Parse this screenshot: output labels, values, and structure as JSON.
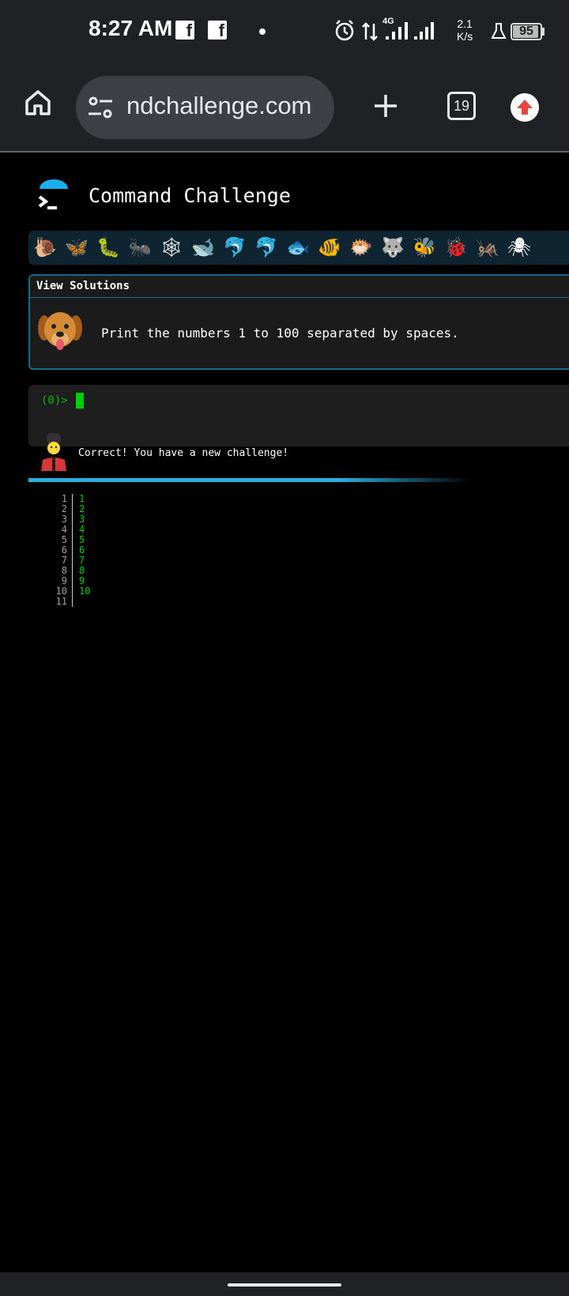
{
  "status_bar": {
    "time": "8:27 AM",
    "network_type": "4G",
    "speed_value": "2.1",
    "speed_unit": "K/s",
    "battery_level": "95",
    "icons": [
      "facebook-icon",
      "facebook-icon",
      "dot-icon",
      "alarm-icon",
      "data-arrows-icon",
      "signal-icon",
      "signal-icon",
      "flask-icon",
      "battery-icon"
    ]
  },
  "browser": {
    "url": "ndchallenge.com",
    "tab_count": "19",
    "icons": [
      "home-icon",
      "tune-icon",
      "plus-icon",
      "tabs-icon",
      "update-icon"
    ]
  },
  "site": {
    "title": "Command Challenge",
    "view_solutions": "View Solutions",
    "challenge_text": "Print the numbers 1 to 100 separated by spaces.",
    "prompt": "(0)>",
    "feedback": "Correct! You have a new challenge!",
    "progress_fraction": 0.7,
    "badges": [
      "🐌",
      "🦋",
      "🐛",
      "🐜",
      "🕸",
      "🐋",
      "🐬",
      "🐬",
      "🐟",
      "🐠",
      "🐡",
      "🐺",
      "🐝",
      "🐞",
      "🦗",
      "🕷"
    ]
  },
  "output": {
    "line_numbers": [
      "1",
      "2",
      "3",
      "4",
      "5",
      "6",
      "7",
      "8",
      "9",
      "10",
      "11"
    ],
    "lines": [
      "1",
      "2",
      "3",
      "4",
      "5",
      "6",
      "7",
      "8",
      "9",
      "10",
      ""
    ]
  },
  "colors": {
    "accent": "#2ab0e0",
    "terminal_green": "#00d000",
    "browser_chrome": "#202124"
  }
}
